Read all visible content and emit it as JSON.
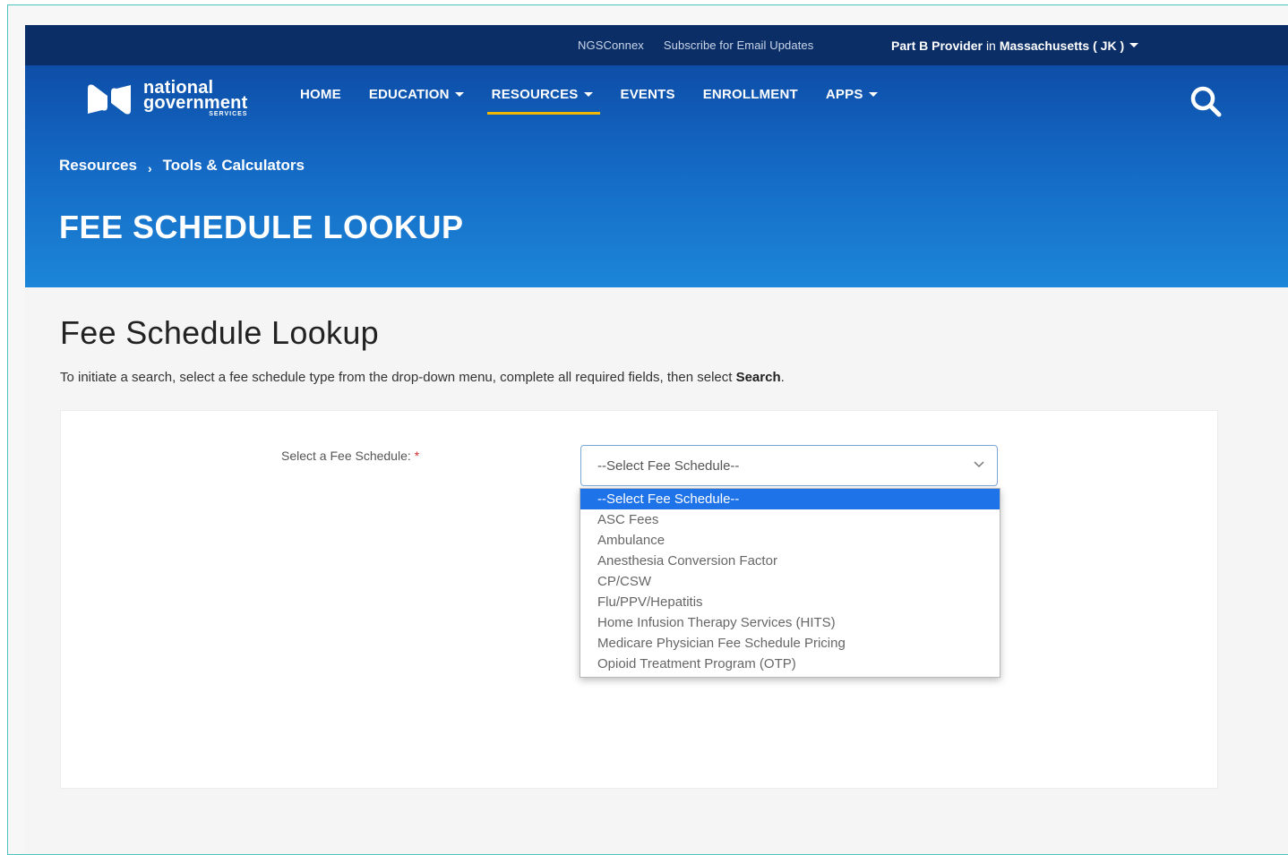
{
  "utility": {
    "links": [
      "NGSConnex",
      "Subscribe for Email Updates"
    ],
    "provider_pre": "Part B Provider",
    "provider_mid": "in",
    "provider_state": "Massachusetts ( JK )"
  },
  "logo": {
    "line1": "national",
    "line2": "government",
    "line3": "SERVICES"
  },
  "nav": [
    {
      "label": "HOME",
      "dropdown": false
    },
    {
      "label": "EDUCATION",
      "dropdown": true
    },
    {
      "label": "RESOURCES",
      "dropdown": true,
      "active": true
    },
    {
      "label": "EVENTS",
      "dropdown": false
    },
    {
      "label": "ENROLLMENT",
      "dropdown": false
    },
    {
      "label": "APPS",
      "dropdown": true
    }
  ],
  "breadcrumb": {
    "item1": "Resources",
    "sep": "›",
    "item2": "Tools & Calculators"
  },
  "page_heading": "FEE SCHEDULE LOOKUP",
  "main": {
    "title": "Fee Schedule Lookup",
    "intro_pre": "To initiate a search, select a fee schedule type from the drop-down menu, complete all required fields, then select ",
    "intro_bold": "Search",
    "intro_post": "."
  },
  "form": {
    "label": "Select a Fee Schedule:",
    "required_mark": "*",
    "selected_value": "--Select Fee Schedule--",
    "options": [
      "--Select Fee Schedule--",
      "ASC Fees",
      "Ambulance",
      "Anesthesia Conversion Factor",
      "CP/CSW",
      "Flu/PPV/Hepatitis",
      "Home Infusion Therapy Services (HITS)",
      "Medicare Physician Fee Schedule Pricing",
      "Opioid Treatment Program (OTP)"
    ]
  },
  "colors": {
    "utility_bg": "#0c2e66",
    "header_bg": "#1469c4",
    "accent": "#f2b800",
    "option_highlight": "#1e73e8"
  }
}
